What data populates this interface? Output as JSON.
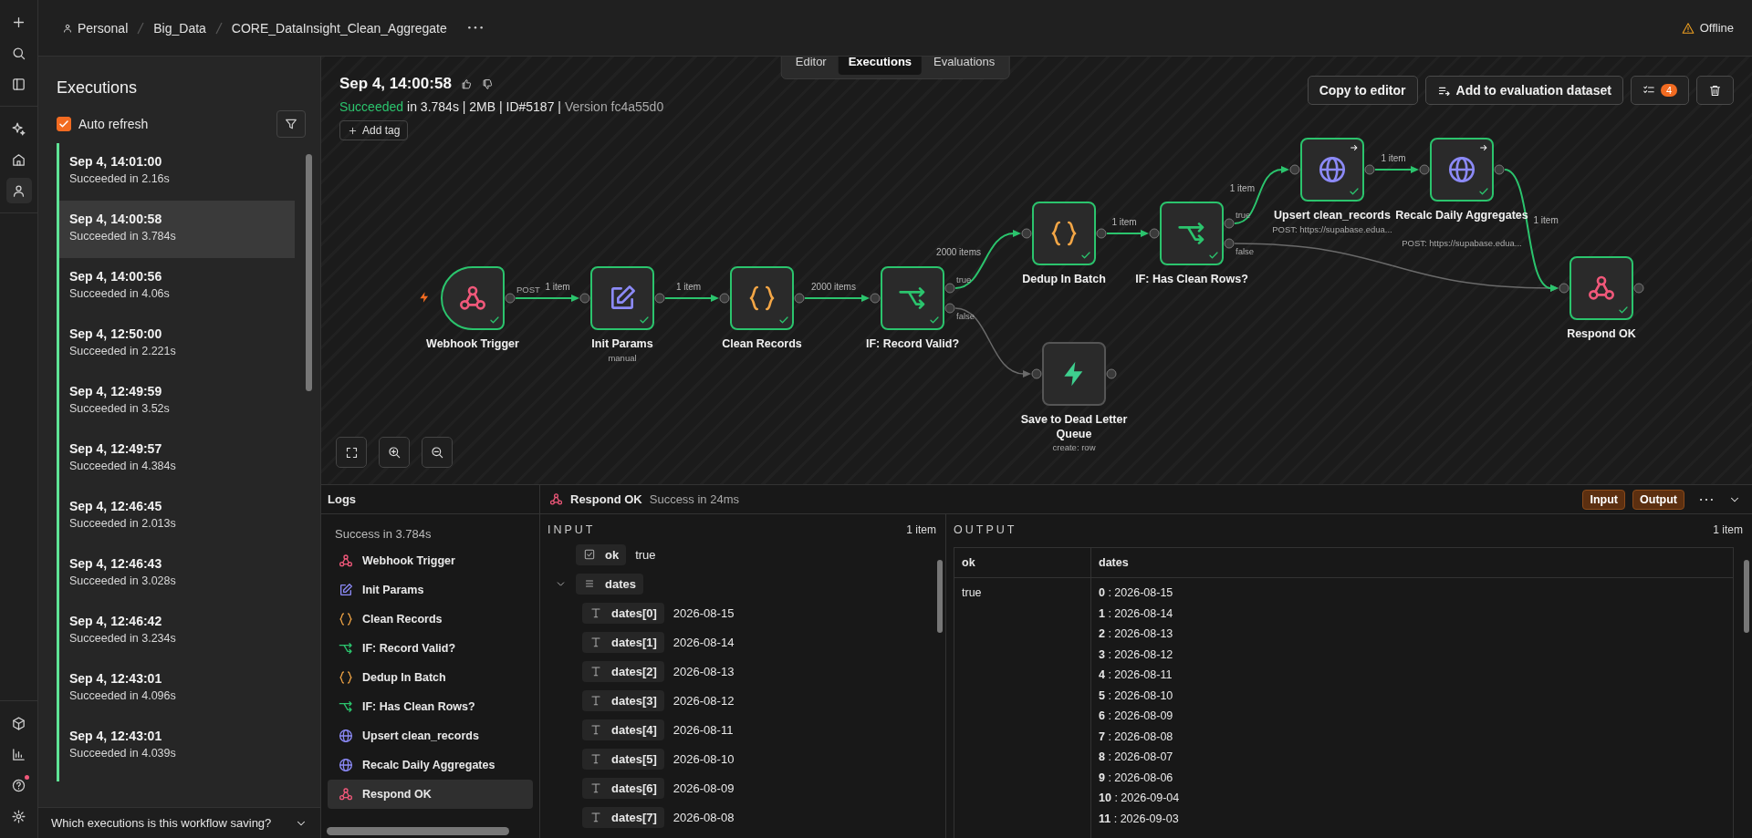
{
  "rail": [
    {
      "kind": "add",
      "selected": false
    },
    {
      "kind": "search",
      "selected": false
    },
    {
      "kind": "panel",
      "selected": false
    },
    {
      "kind": "sparkle",
      "selected": false
    },
    {
      "kind": "home",
      "selected": false
    },
    {
      "kind": "person",
      "selected": true
    },
    {
      "kind": "cube",
      "selected": false
    },
    {
      "kind": "chart",
      "selected": false
    },
    {
      "kind": "help",
      "selected": false
    },
    {
      "kind": "gear",
      "selected": false
    }
  ],
  "breadcrumb": [
    "Personal",
    "Big_Data",
    "CORE_DataInsight_Clean_Aggregate"
  ],
  "connection_status": "Offline",
  "tabs": [
    {
      "label": "Editor",
      "selected": false
    },
    {
      "label": "Executions",
      "selected": true
    },
    {
      "label": "Evaluations",
      "selected": false
    }
  ],
  "executions_panel": {
    "title": "Executions",
    "auto_refresh": {
      "label": "Auto refresh",
      "checked": true
    },
    "items": [
      {
        "time": "Sep 4, 14:01:00",
        "status": "Succeeded in 2.16s",
        "selected": false
      },
      {
        "time": "Sep 4, 14:00:58",
        "status": "Succeeded in 3.784s",
        "selected": true
      },
      {
        "time": "Sep 4, 14:00:56",
        "status": "Succeeded in 4.06s",
        "selected": false
      },
      {
        "time": "Sep 4, 12:50:00",
        "status": "Succeeded in 2.221s",
        "selected": false
      },
      {
        "time": "Sep 4, 12:49:59",
        "status": "Succeeded in 3.52s",
        "selected": false
      },
      {
        "time": "Sep 4, 12:49:57",
        "status": "Succeeded in 4.384s",
        "selected": false
      },
      {
        "time": "Sep 4, 12:46:45",
        "status": "Succeeded in 2.013s",
        "selected": false
      },
      {
        "time": "Sep 4, 12:46:43",
        "status": "Succeeded in 3.028s",
        "selected": false
      },
      {
        "time": "Sep 4, 12:46:42",
        "status": "Succeeded in 3.234s",
        "selected": false
      },
      {
        "time": "Sep 4, 12:43:01",
        "status": "Succeeded in 4.096s",
        "selected": false
      },
      {
        "time": "Sep 4, 12:43:01",
        "status": "Succeeded in 4.039s",
        "selected": false
      }
    ],
    "footer": "Which executions is this workflow saving?"
  },
  "execution": {
    "title": "Sep 4, 14:00:58",
    "status": "Succeeded",
    "details": "in 3.784s | 2MB | ID#5187 |",
    "version": "Version fc4a55d0",
    "add_tag": "Add tag",
    "actions": [
      "Copy to editor",
      "Add to evaluation dataset"
    ],
    "task_count": "4"
  },
  "nodes": [
    {
      "kind": "webhook",
      "label": "Webhook Trigger",
      "outputs": [
        "POST"
      ],
      "executed": true
    },
    {
      "kind": "edit",
      "label": "Init Params",
      "subtitle": "manual",
      "executed": true
    },
    {
      "kind": "code",
      "label": "Clean Records",
      "executed": true
    },
    {
      "kind": "if",
      "label": "IF: Record Valid?",
      "outputs": [
        "true",
        "false"
      ],
      "executed": true
    },
    {
      "kind": "code",
      "label": "Dedup In Batch",
      "executed": true
    },
    {
      "kind": "if",
      "label": "IF: Has Clean Rows?",
      "outputs": [
        "true",
        "false"
      ],
      "executed": true
    },
    {
      "kind": "http",
      "label": "Upsert clean_records",
      "subtitle": "POST: https://supabase.edua...",
      "executed": true
    },
    {
      "kind": "http",
      "label": "Recalc Daily Aggregates",
      "subtitle": "POST: https://supabase.edua...",
      "executed": true
    },
    {
      "kind": "webhook",
      "label": "Respond OK",
      "executed": true
    },
    {
      "kind": "supabase",
      "label": "Save to Dead Letter Queue",
      "subtitle": "create: row",
      "executed": false
    }
  ],
  "connections": [
    {
      "label": "1 item",
      "executed": true
    },
    {
      "label": "1 item",
      "executed": true
    },
    {
      "label": "2000 items",
      "executed": true
    },
    {
      "label": "2000 items",
      "executed": true
    },
    {
      "executed": false
    },
    {
      "label": "1 item",
      "executed": true
    },
    {
      "label": "1 item",
      "executed": true
    },
    {
      "executed": false
    },
    {
      "label": "1 item",
      "executed": true
    },
    {
      "label": "1 item",
      "executed": true
    }
  ],
  "logs": {
    "title": "Logs",
    "summary": "Success in 3.784s",
    "entries": [
      {
        "kind": "webhook",
        "label": "Webhook Trigger",
        "selected": false
      },
      {
        "kind": "edit",
        "label": "Init Params",
        "selected": false
      },
      {
        "kind": "code",
        "label": "Clean Records",
        "selected": false
      },
      {
        "kind": "if",
        "label": "IF: Record Valid?",
        "selected": false
      },
      {
        "kind": "code",
        "label": "Dedup In Batch",
        "selected": false
      },
      {
        "kind": "if",
        "label": "IF: Has Clean Rows?",
        "selected": false
      },
      {
        "kind": "http",
        "label": "Upsert clean_records",
        "selected": false
      },
      {
        "kind": "http",
        "label": "Recalc Daily Aggregates",
        "selected": false
      },
      {
        "kind": "webhook",
        "label": "Respond OK",
        "selected": true
      }
    ]
  },
  "detail": {
    "node": {
      "kind": "webhook",
      "label": "Respond OK"
    },
    "status": "Success in 24ms",
    "buttons": [
      "Input",
      "Output"
    ],
    "input": {
      "title": "INPUT",
      "count": "1 item",
      "fields": [
        {
          "kind": "boolean",
          "key": "ok",
          "value": "true"
        },
        {
          "kind": "array",
          "key": "dates",
          "expanded": true,
          "children": [
            {
              "kind": "string",
              "key": "dates[0]",
              "value": "2026-08-15"
            },
            {
              "kind": "string",
              "key": "dates[1]",
              "value": "2026-08-14"
            },
            {
              "kind": "string",
              "key": "dates[2]",
              "value": "2026-08-13"
            },
            {
              "kind": "string",
              "key": "dates[3]",
              "value": "2026-08-12"
            },
            {
              "kind": "string",
              "key": "dates[4]",
              "value": "2026-08-11"
            },
            {
              "kind": "string",
              "key": "dates[5]",
              "value": "2026-08-10"
            },
            {
              "kind": "string",
              "key": "dates[6]",
              "value": "2026-08-09"
            },
            {
              "kind": "string",
              "key": "dates[7]",
              "value": "2026-08-08"
            }
          ]
        }
      ]
    },
    "output": {
      "title": "OUTPUT",
      "count": "1 item",
      "columns": [
        "ok",
        "dates"
      ],
      "rows": [
        {
          "ok": "true",
          "dates": [
            "**0** : 2026-08-15",
            "**1** : 2026-08-14",
            "**2** : 2026-08-13",
            "**3** : 2026-08-12",
            "**4** : 2026-08-11",
            "**5** : 2026-08-10",
            "**6** : 2026-08-09",
            "**7** : 2026-08-08",
            "**8** : 2026-08-07",
            "**9** : 2026-08-06",
            "**10** : 2026-09-04",
            "**11** : 2026-09-03"
          ]
        }
      ]
    }
  }
}
